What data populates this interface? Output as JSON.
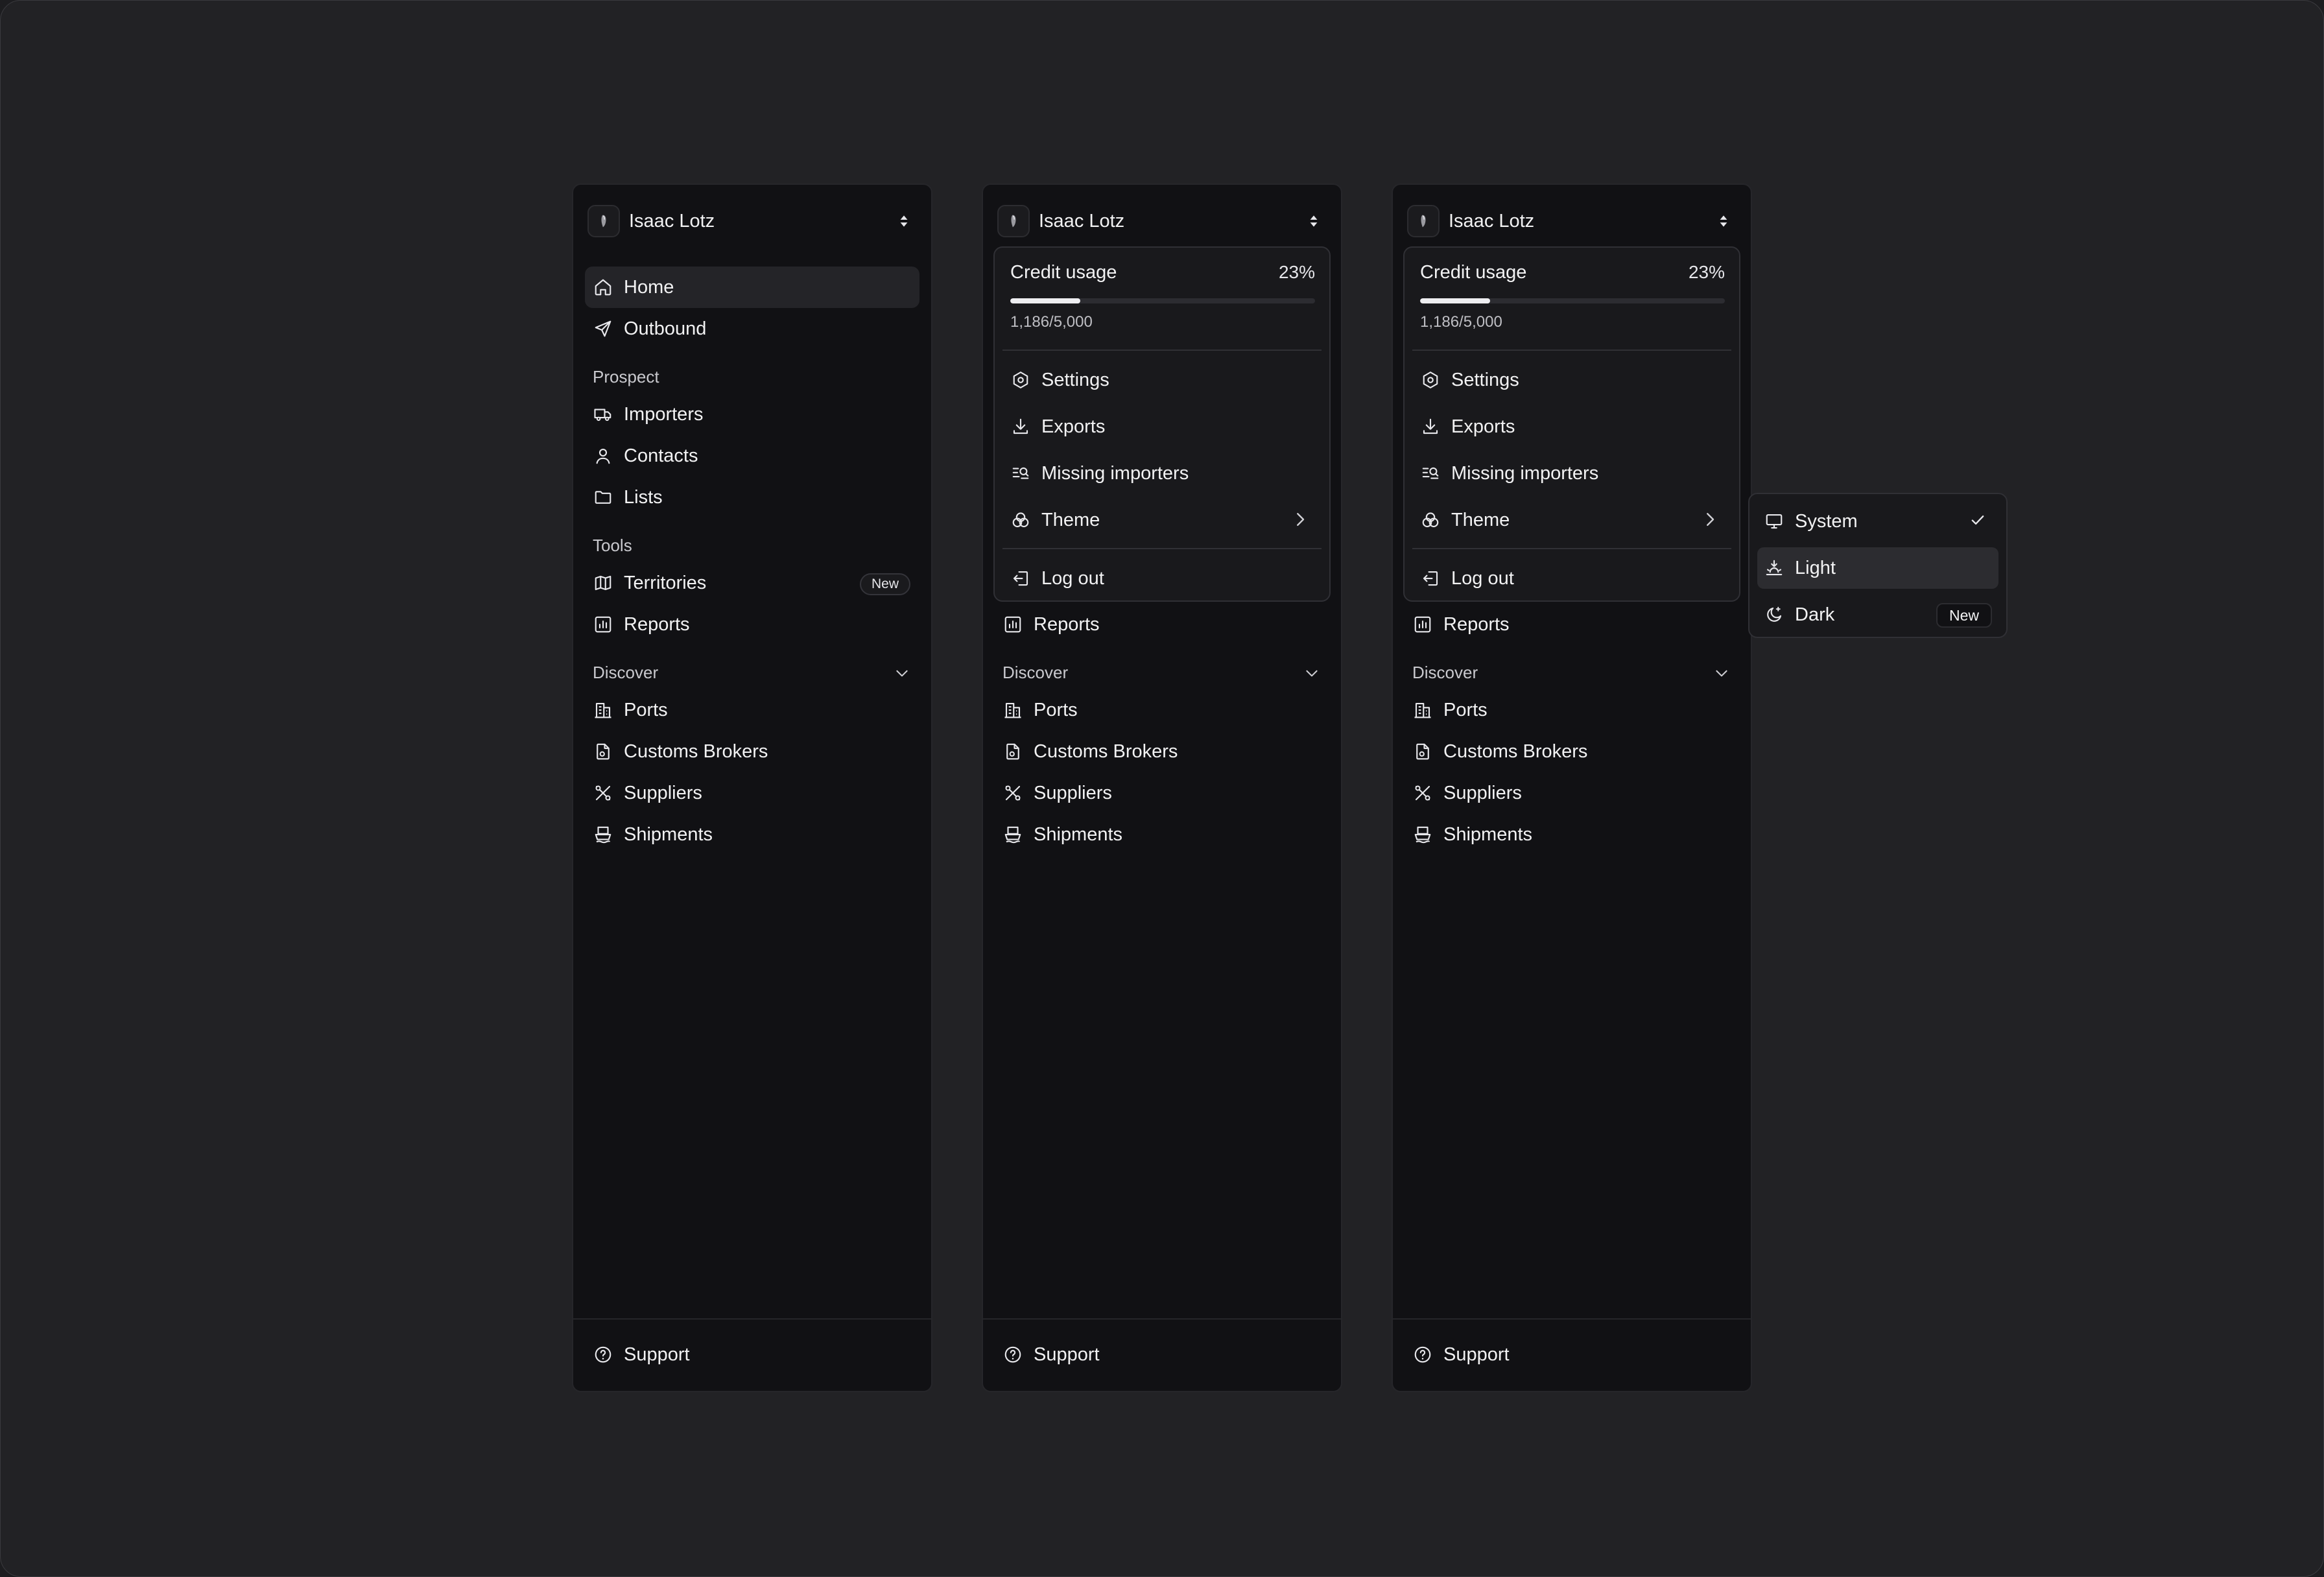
{
  "user": {
    "name": "Isaac Lotz"
  },
  "nav": {
    "home": "Home",
    "outbound": "Outbound",
    "prospect_section": "Prospect",
    "importers": "Importers",
    "contacts": "Contacts",
    "lists": "Lists",
    "tools_section": "Tools",
    "territories": "Territories",
    "territories_badge": "New",
    "reports": "Reports",
    "discover_section": "Discover",
    "ports": "Ports",
    "customs_brokers": "Customs Brokers",
    "suppliers": "Suppliers",
    "shipments": "Shipments",
    "support": "Support"
  },
  "account_menu": {
    "credit_title": "Credit usage",
    "credit_percent": "23%",
    "credit_fraction": 0.23,
    "credit_count": "1,186/5,000",
    "settings": "Settings",
    "exports": "Exports",
    "missing_importers": "Missing importers",
    "theme": "Theme",
    "logout": "Log out"
  },
  "theme_menu": {
    "system": "System",
    "light": "Light",
    "dark": "Dark",
    "dark_badge": "New",
    "selected": "System",
    "highlighted": "Light"
  },
  "colors": {
    "background": "#222225",
    "panel": "#111114",
    "popover": "#19191c",
    "active_item": "#242428",
    "text": "#f2f2f3"
  }
}
